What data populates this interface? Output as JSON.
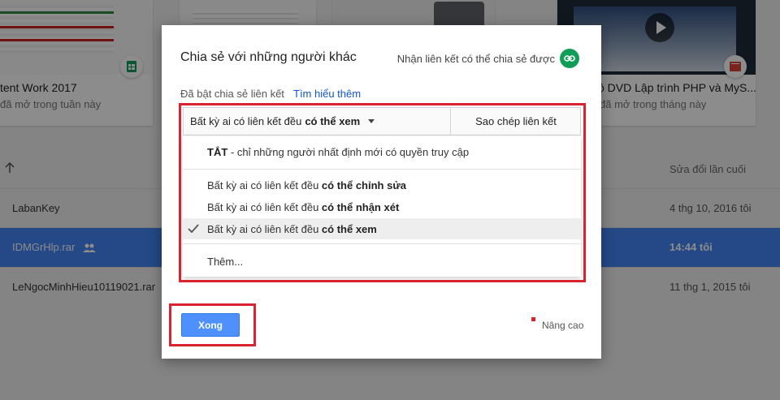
{
  "background": {
    "cards": [
      {
        "name": "tent Work 2017",
        "sub": "đã mở trong tuần này",
        "type_icon": "sheets-icon"
      },
      {
        "name": "",
        "sub": "",
        "type_icon": ""
      },
      {
        "name": "",
        "sub": "",
        "type_icon": ""
      },
      {
        "name": "ộ DVD Lập trình PHP và MyS...",
        "sub": "đã mở trong tháng này",
        "type_icon": "video-icon"
      }
    ],
    "list_header": {
      "sort_icon": "arrow-up-icon",
      "modified_label": "Sửa đổi lần cuối"
    },
    "rows": [
      {
        "name": "LabanKey",
        "date": "4 thg 10, 2016 tôi",
        "selected": false
      },
      {
        "name": "IDMGrHlp.rar",
        "date": "14:44 tôi",
        "selected": true,
        "shared_icon": "people-icon"
      },
      {
        "name": "LeNgocMinhHieu10119021.rar",
        "date": "11 thg 1, 2015 tôi",
        "selected": false
      }
    ]
  },
  "dialog": {
    "title": "Chia sẻ với những người khác",
    "get_link_label": "Nhận liên kết có thể chia sẻ được",
    "link_icon": "link-icon",
    "link_status": "Đã bật chia sẻ liên kết",
    "learn_more": "Tìm hiểu thêm",
    "access_select": {
      "prefix": "Bất kỳ ai có liên kết đều",
      "bold": "có thể xem"
    },
    "copy_link": "Sao chép liên kết",
    "menu": {
      "off_bold": "TẮT",
      "off_rest": " - chỉ những người nhất định mới có quyền truy cập",
      "options": [
        {
          "prefix": "Bất kỳ ai có liên kết đều ",
          "bold": "có thể chỉnh sửa"
        },
        {
          "prefix": "Bất kỳ ai có liên kết đều ",
          "bold": "có thể nhận xét"
        },
        {
          "prefix": "Bất kỳ ai có liên kết đều ",
          "bold": "có thể xem"
        }
      ],
      "more": "Thêm..."
    },
    "done_button": "Xong",
    "advanced": "Nâng cao"
  },
  "colors": {
    "accent": "#4285f4",
    "highlight_box": "#d9232e",
    "link_green": "#0f9d58",
    "done_button": "#4d90fe"
  }
}
